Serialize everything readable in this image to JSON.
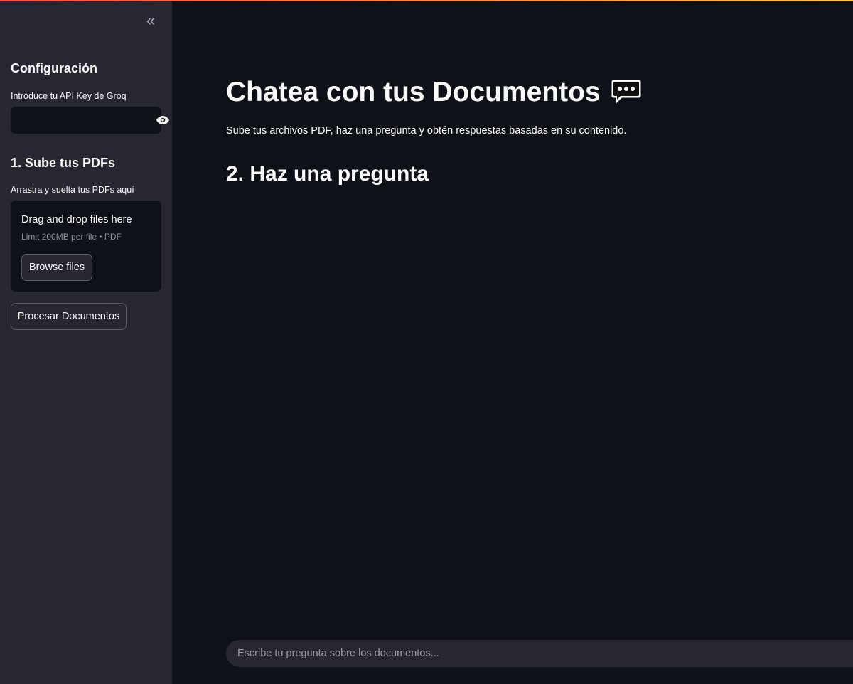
{
  "sidebar": {
    "collapse_glyph": "«",
    "config_header": "Configuración",
    "api_key_label": "Introduce tu API Key de Groq",
    "api_key_value": "",
    "upload_header": "1. Sube tus PDFs",
    "upload_label": "Arrastra y suelta tus PDFs aquí",
    "dropzone": {
      "title": "Drag and drop files here",
      "limit": "Limit 200MB per file • PDF",
      "browse_label": "Browse files"
    },
    "process_label": "Procesar Documentos"
  },
  "main": {
    "title": "Chatea con tus Documentos",
    "title_icon": "speech-balloon-icon",
    "subtitle": "Sube tus archivos PDF, haz una pregunta y obtén respuestas basadas en su contenido.",
    "section_header": "2. Haz una pregunta",
    "chat_placeholder": "Escribe tu pregunta sobre los documentos..."
  },
  "colors": {
    "background": "#0e1117",
    "sidebar": "#262730",
    "text": "#fafafa",
    "accent": "#ff4b4b"
  }
}
